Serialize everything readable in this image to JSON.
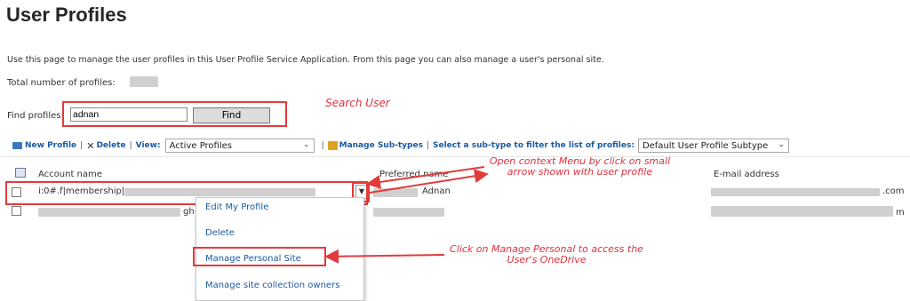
{
  "page": {
    "title": "User Profiles",
    "description": "Use this page to manage the user profiles in this User Profile Service Application. From this page you can also manage a user's personal site.",
    "total_label": "Total number of profiles:"
  },
  "find": {
    "label": "Find profiles",
    "value": "adnan",
    "button": "Find"
  },
  "toolbar": {
    "new_profile": "New Profile",
    "delete": "Delete",
    "view_label": "View:",
    "view_selected": "Active Profiles",
    "manage_subtypes": "Manage Sub-types",
    "filter_label": "Select a sub-type to filter the list of profiles:",
    "subtype_selected": "Default User Profile Subtype",
    "separator": "|"
  },
  "table": {
    "columns": [
      "Account name",
      "Preferred name",
      "E-mail address"
    ],
    "rows": [
      {
        "account": "i:0#.f|membership|",
        "preferred": "Adnan",
        "email": ".com"
      },
      {
        "account": "",
        "preferred": "",
        "email": "m",
        "account_fragment": "gh"
      }
    ]
  },
  "context_menu": {
    "items": [
      "Edit My Profile",
      "Delete",
      "Manage Personal Site",
      "Manage site collection owners"
    ]
  },
  "annotations": {
    "search": "Search User",
    "context": "Open context Menu by click on small arrow shown with user profile",
    "manage": "Click on Manage Personal to access the User's OneDrive"
  },
  "colors": {
    "link": "#1a5aa0",
    "annotation_red": "#e03c3c"
  }
}
